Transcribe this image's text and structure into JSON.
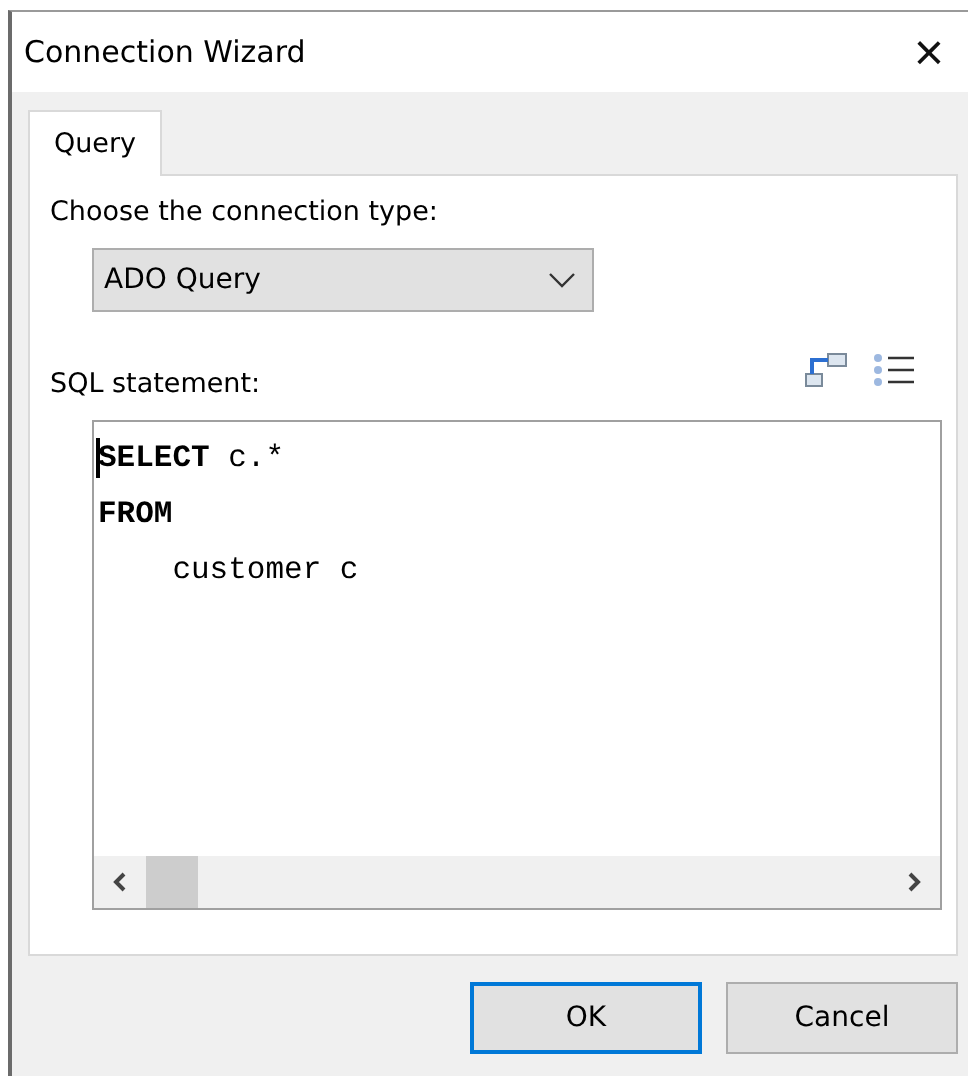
{
  "window": {
    "title": "Connection Wizard",
    "close": "×"
  },
  "tabs": [
    {
      "label": "Query",
      "selected": true
    }
  ],
  "connection_type": {
    "label": "Choose the connection type:",
    "value": "ADO Query"
  },
  "sql": {
    "label": "SQL statement:",
    "lines": [
      "**SELECT** c.*",
      "**FROM**",
      "    customer c"
    ]
  },
  "buttons": [
    {
      "label": "OK",
      "default": true
    },
    {
      "label": "Cancel",
      "default": false
    }
  ]
}
